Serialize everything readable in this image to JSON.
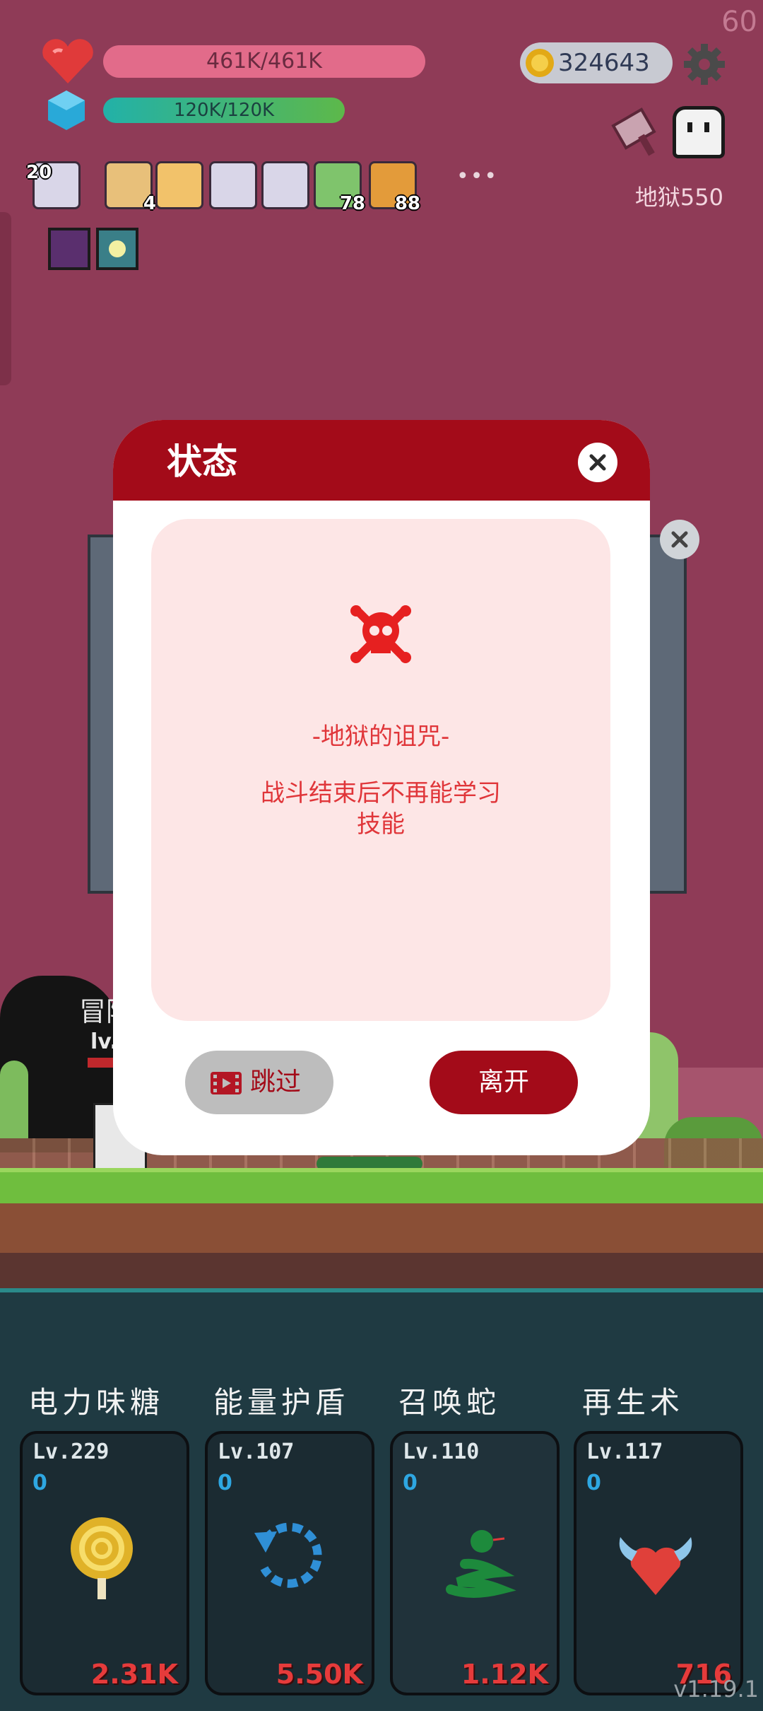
{
  "hud": {
    "fps": "60",
    "hp_text": "461K/461K",
    "hp_fill": 1.0,
    "energy_text": "120K/120K",
    "energy_fill": 1.0,
    "coins": "324643",
    "stage": "地狱550",
    "items": [
      {
        "icon": "scroll-gift-icon",
        "count": "20"
      },
      {
        "icon": "map-icon",
        "count": "4"
      },
      {
        "icon": "recipe-icon",
        "count": ""
      },
      {
        "icon": "scroll-gift-icon",
        "count": ""
      },
      {
        "icon": "scroll-gift-icon",
        "count": ""
      },
      {
        "icon": "cash-heart-icon",
        "count": "78"
      },
      {
        "icon": "book-icon",
        "count": "88"
      }
    ],
    "more": "•••"
  },
  "scene": {
    "player_name_partial": "冒险",
    "player_lv_partial": "lv."
  },
  "dialog": {
    "title": "状态",
    "curse_title": "-地狱的诅咒-",
    "curse_desc": "战斗结束后不再能学习技能",
    "skip_label": "跳过",
    "leave_label": "离开",
    "colors": {
      "header": "#a30b19",
      "panel": "#fde6e6",
      "text": "#e0363a"
    }
  },
  "skills": [
    {
      "name": "电力味糖",
      "lv": "Lv.229",
      "points": "0",
      "cost": "2.31K",
      "icon": "lollipop-icon"
    },
    {
      "name": "能量护盾",
      "lv": "Lv.107",
      "points": "0",
      "cost": "5.50K",
      "icon": "rotate-shield-icon"
    },
    {
      "name": "召唤蛇",
      "lv": "Lv.110",
      "points": "0",
      "cost": "1.12K",
      "icon": "snake-icon"
    },
    {
      "name": "再生术",
      "lv": "Lv.117",
      "points": "0",
      "cost": "716",
      "icon": "winged-heart-icon"
    }
  ],
  "version": "v1.19.1"
}
